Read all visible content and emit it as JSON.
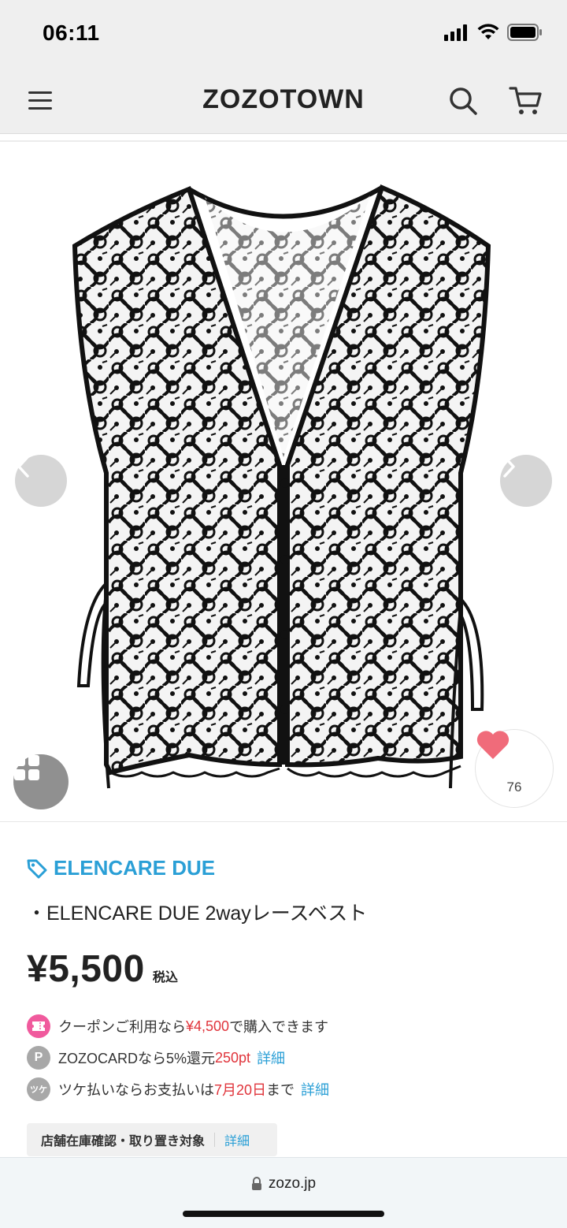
{
  "status": {
    "time": "06:11"
  },
  "nav": {
    "logo": "ZOZOTOWN"
  },
  "product": {
    "brand": "ELENCARE DUE",
    "title": "・ELENCARE DUE 2wayレースベスト",
    "price": "¥5,500",
    "tax_label": "税込",
    "favorite_count": "76"
  },
  "info": {
    "coupon_prefix": "クーポンご利用なら",
    "coupon_price": "¥4,500",
    "coupon_suffix": "で購入できます",
    "card_prefix": "ZOZOCARDなら5%還元",
    "card_points": "250pt",
    "card_link": "詳細",
    "tsuke_prefix": "ツケ払いならお支払いは",
    "tsuke_date": "7月20日",
    "tsuke_suffix": "まで",
    "tsuke_link": "詳細",
    "coupon_icon_color": "#f05a9d",
    "point_icon_label": "P",
    "point_icon_color": "#a8a8a8",
    "tsuke_icon_label": "ツケ",
    "tsuke_icon_color": "#a8a8a8"
  },
  "store": {
    "label": "店舗在庫確認・取り置き対象",
    "link": "詳細"
  },
  "browser": {
    "url": "zozo.jp"
  },
  "colors": {
    "accent": "#2a9fd6",
    "sale": "#e0343b",
    "heart": "#f06b7a"
  }
}
